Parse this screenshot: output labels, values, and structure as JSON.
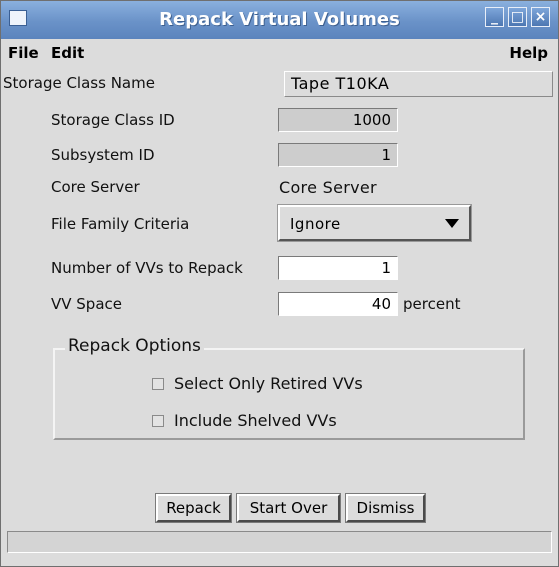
{
  "window": {
    "title": "Repack Virtual Volumes"
  },
  "menu": {
    "file": "File",
    "edit": "Edit",
    "help": "Help"
  },
  "form": {
    "storage_class_name_label": "Storage Class Name",
    "storage_class_name_value": "Tape T10KA",
    "storage_class_id_label": "Storage Class ID",
    "storage_class_id_value": "1000",
    "subsystem_id_label": "Subsystem ID",
    "subsystem_id_value": "1",
    "core_server_label": "Core Server",
    "core_server_value": "Core Server",
    "file_family_label": "File Family Criteria",
    "file_family_value": "Ignore",
    "num_vvs_label": "Number of VVs to Repack",
    "num_vvs_value": "1",
    "vv_space_label": "VV Space",
    "vv_space_value": "40",
    "vv_space_unit": "percent"
  },
  "options": {
    "legend": "Repack Options",
    "select_retired_label": "Select Only Retired VVs",
    "select_retired_checked": false,
    "include_shelved_label": "Include Shelved VVs",
    "include_shelved_checked": false
  },
  "buttons": {
    "repack": "Repack",
    "start_over": "Start Over",
    "dismiss": "Dismiss"
  },
  "status": {
    "text": ""
  },
  "colors": {
    "titlebar": "#6a92c8",
    "background": "#dcdcdc"
  }
}
